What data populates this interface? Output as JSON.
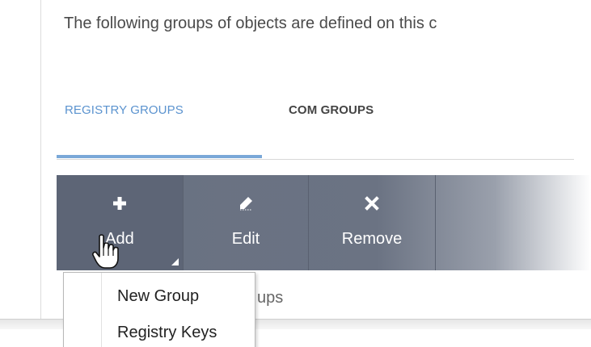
{
  "intro_text": "The following groups of objects are defined on this c",
  "tabs": [
    {
      "label": "REGISTRY GROUPS",
      "active": true
    },
    {
      "label": "COM GROUPS",
      "active": false
    }
  ],
  "toolbar": {
    "add_label": "Add",
    "edit_label": "Edit",
    "remove_label": "Remove",
    "add_icon": "plus-icon",
    "edit_icon": "pencil-icon",
    "remove_icon": "x-icon"
  },
  "under_text": "ups",
  "add_menu": {
    "items": [
      "New Group",
      "Registry Keys"
    ]
  },
  "colors": {
    "active_tab": "#5b93cf",
    "toolbar_bg": "#687182",
    "add_button_bg": "#5d6576"
  }
}
